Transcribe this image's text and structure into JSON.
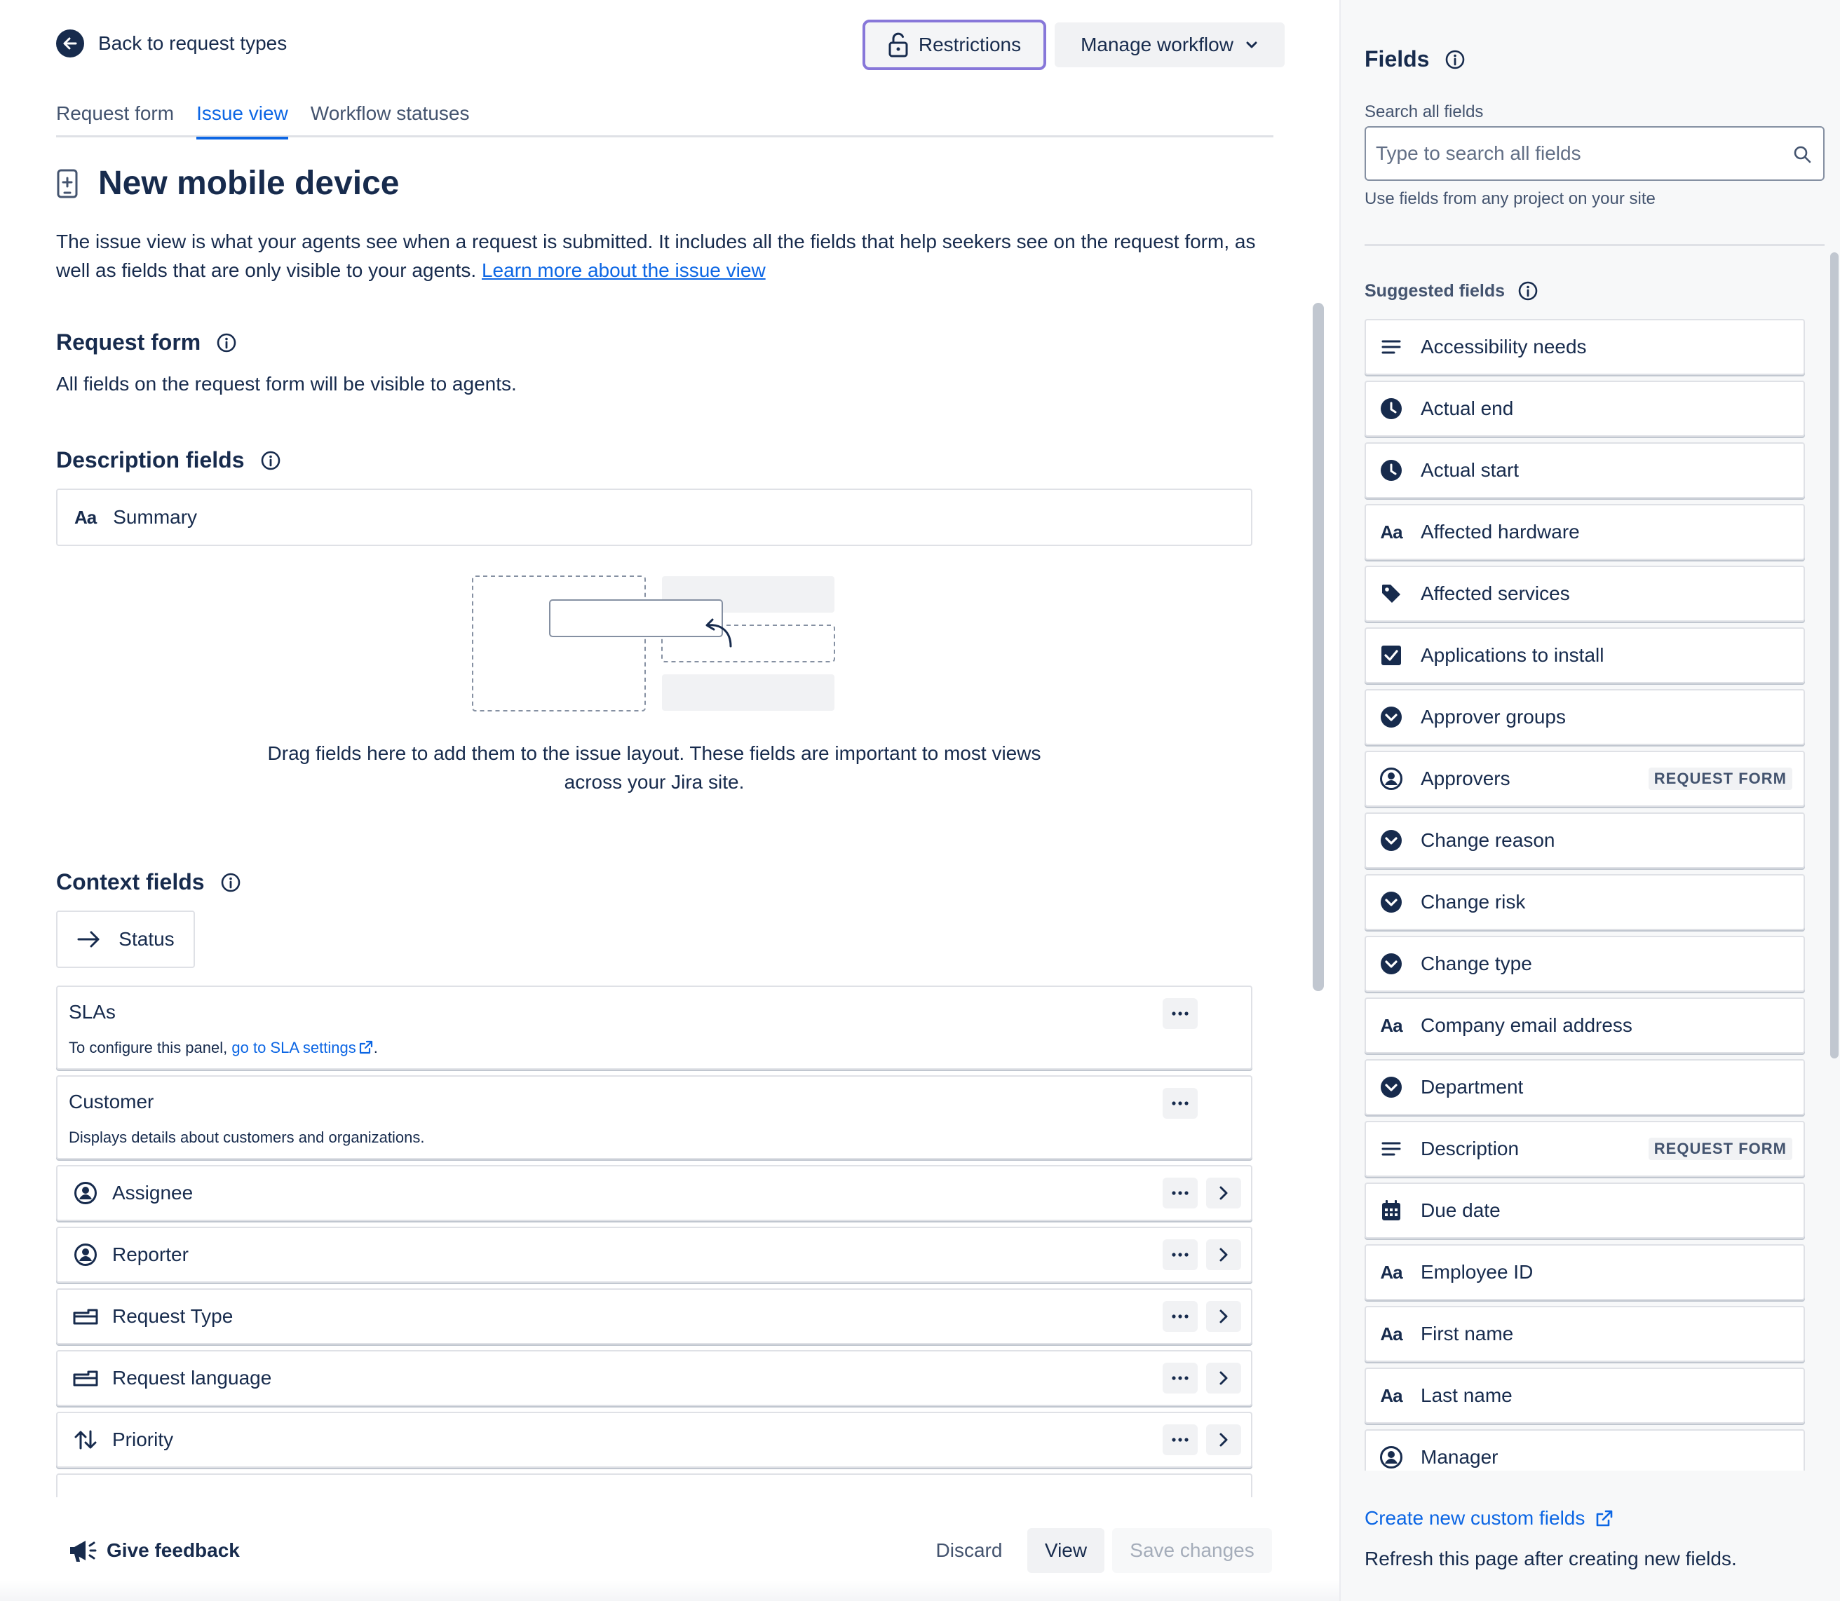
{
  "header": {
    "back_label": "Back to request types",
    "restrictions_label": "Restrictions",
    "manage_workflow_label": "Manage workflow"
  },
  "tabs": [
    {
      "label": "Request form",
      "active": false
    },
    {
      "label": "Issue view",
      "active": true
    },
    {
      "label": "Workflow statuses",
      "active": false
    }
  ],
  "page": {
    "title": "New mobile device",
    "intro_text": "The issue view is what your agents see when a request is submitted. It includes all the fields that help seekers see on the request form, as well as fields that are only visible to your agents. ",
    "intro_link": "Learn more about the issue view"
  },
  "request_form_section": {
    "title": "Request form",
    "text": "All fields on the request form will be visible to agents."
  },
  "description_section": {
    "title": "Description fields",
    "summary_icon": "Aa",
    "summary_label": "Summary",
    "drop_text": "Drag fields here to add them to the issue layout. These fields are important to most views across your Jira site."
  },
  "context_section": {
    "title": "Context fields",
    "status_label": "Status",
    "sla": {
      "title": "SLAs",
      "desc_prefix": "To configure this panel, ",
      "desc_link": "go to SLA settings",
      "desc_suffix": "."
    },
    "customer": {
      "title": "Customer",
      "desc": "Displays details about customers and organizations."
    },
    "rows": [
      {
        "label": "Assignee",
        "icon": "person-icon"
      },
      {
        "label": "Reporter",
        "icon": "person-icon"
      },
      {
        "label": "Request Type",
        "icon": "request-type-icon"
      },
      {
        "label": "Request language",
        "icon": "request-type-icon"
      },
      {
        "label": "Priority",
        "icon": "priority-icon"
      }
    ]
  },
  "footer": {
    "feedback_label": "Give feedback",
    "discard_label": "Discard",
    "view_label": "View",
    "save_label": "Save changes"
  },
  "sidebar": {
    "title": "Fields",
    "search_label": "Search all fields",
    "search_placeholder": "Type to search all fields",
    "search_value": "",
    "search_help": "Use fields from any project on your site",
    "suggested_title": "Suggested fields",
    "fields": [
      {
        "label": "Accessibility needs",
        "icon": "paragraph-icon",
        "badge": ""
      },
      {
        "label": "Actual end",
        "icon": "clock-icon",
        "badge": ""
      },
      {
        "label": "Actual start",
        "icon": "clock-icon",
        "badge": ""
      },
      {
        "label": "Affected hardware",
        "icon": "text-icon",
        "badge": ""
      },
      {
        "label": "Affected services",
        "icon": "tag-icon",
        "badge": ""
      },
      {
        "label": "Applications to install",
        "icon": "checkbox-icon",
        "badge": ""
      },
      {
        "label": "Approver groups",
        "icon": "select-icon",
        "badge": ""
      },
      {
        "label": "Approvers",
        "icon": "person-icon",
        "badge": "REQUEST FORM"
      },
      {
        "label": "Change reason",
        "icon": "select-icon",
        "badge": ""
      },
      {
        "label": "Change risk",
        "icon": "select-icon",
        "badge": ""
      },
      {
        "label": "Change type",
        "icon": "select-icon",
        "badge": ""
      },
      {
        "label": "Company email address",
        "icon": "text-icon",
        "badge": ""
      },
      {
        "label": "Department",
        "icon": "select-icon",
        "badge": ""
      },
      {
        "label": "Description",
        "icon": "paragraph-icon",
        "badge": "REQUEST FORM"
      },
      {
        "label": "Due date",
        "icon": "calendar-icon",
        "badge": ""
      },
      {
        "label": "Employee ID",
        "icon": "text-icon",
        "badge": ""
      },
      {
        "label": "First name",
        "icon": "text-icon",
        "badge": ""
      },
      {
        "label": "Last name",
        "icon": "text-icon",
        "badge": ""
      },
      {
        "label": "Manager",
        "icon": "person-icon",
        "badge": ""
      }
    ],
    "text_icon_glyph": "Aa",
    "create_link": "Create new custom fields",
    "refresh_text": "Refresh this page after creating new fields."
  },
  "colors": {
    "accent": "#0c66e4",
    "focus_border": "#8777d9",
    "text": "#172b4d"
  }
}
